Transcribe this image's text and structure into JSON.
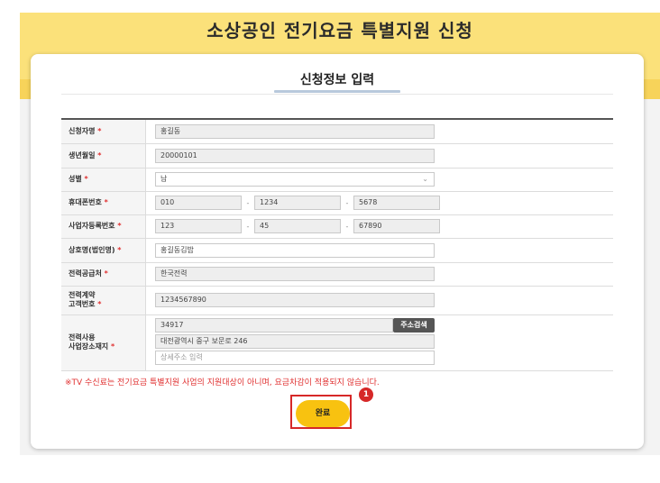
{
  "page": {
    "title": "소상공인 전기요금 특별지원 신청"
  },
  "section": {
    "title": "신청정보 입력"
  },
  "fields": {
    "applicant_name": {
      "label": "신청자명",
      "value": "홍길동"
    },
    "birth_date": {
      "label": "생년월일",
      "value": "20000101"
    },
    "gender": {
      "label": "성별",
      "value": "남"
    },
    "mobile": {
      "label": "휴대폰번호",
      "part1": "010",
      "part2": "1234",
      "part3": "5678"
    },
    "business_reg_no": {
      "label": "사업자등록번호",
      "part1": "123",
      "part2": "45",
      "part3": "67890"
    },
    "business_name": {
      "label": "상호명(법인명)",
      "value": "홍길동김밥"
    },
    "power_supplier": {
      "label": "전력공급처",
      "value": "한국전력"
    },
    "contract_no": {
      "label_line1": "전력계약",
      "label_line2": "고객번호",
      "value": "1234567890"
    },
    "address": {
      "label_line1": "전력사용",
      "label_line2": "사업장소재지",
      "postcode": "34917",
      "search_button": "주소검색",
      "road_address": "대전광역시 중구 보문로 246",
      "detail_placeholder": "상세주소 입력"
    }
  },
  "required_mark": "*",
  "dash": "-",
  "notice": "※TV 수신료는 전기요금 특별지원 사업의 지원대상이 아니며, 요금차감이 적용되지 않습니다.",
  "complete_button": "완료",
  "step_badge": "1",
  "colors": {
    "banner": "#fbe17a",
    "button": "#f8c210",
    "highlight": "#d62828",
    "required": "#e03030"
  }
}
